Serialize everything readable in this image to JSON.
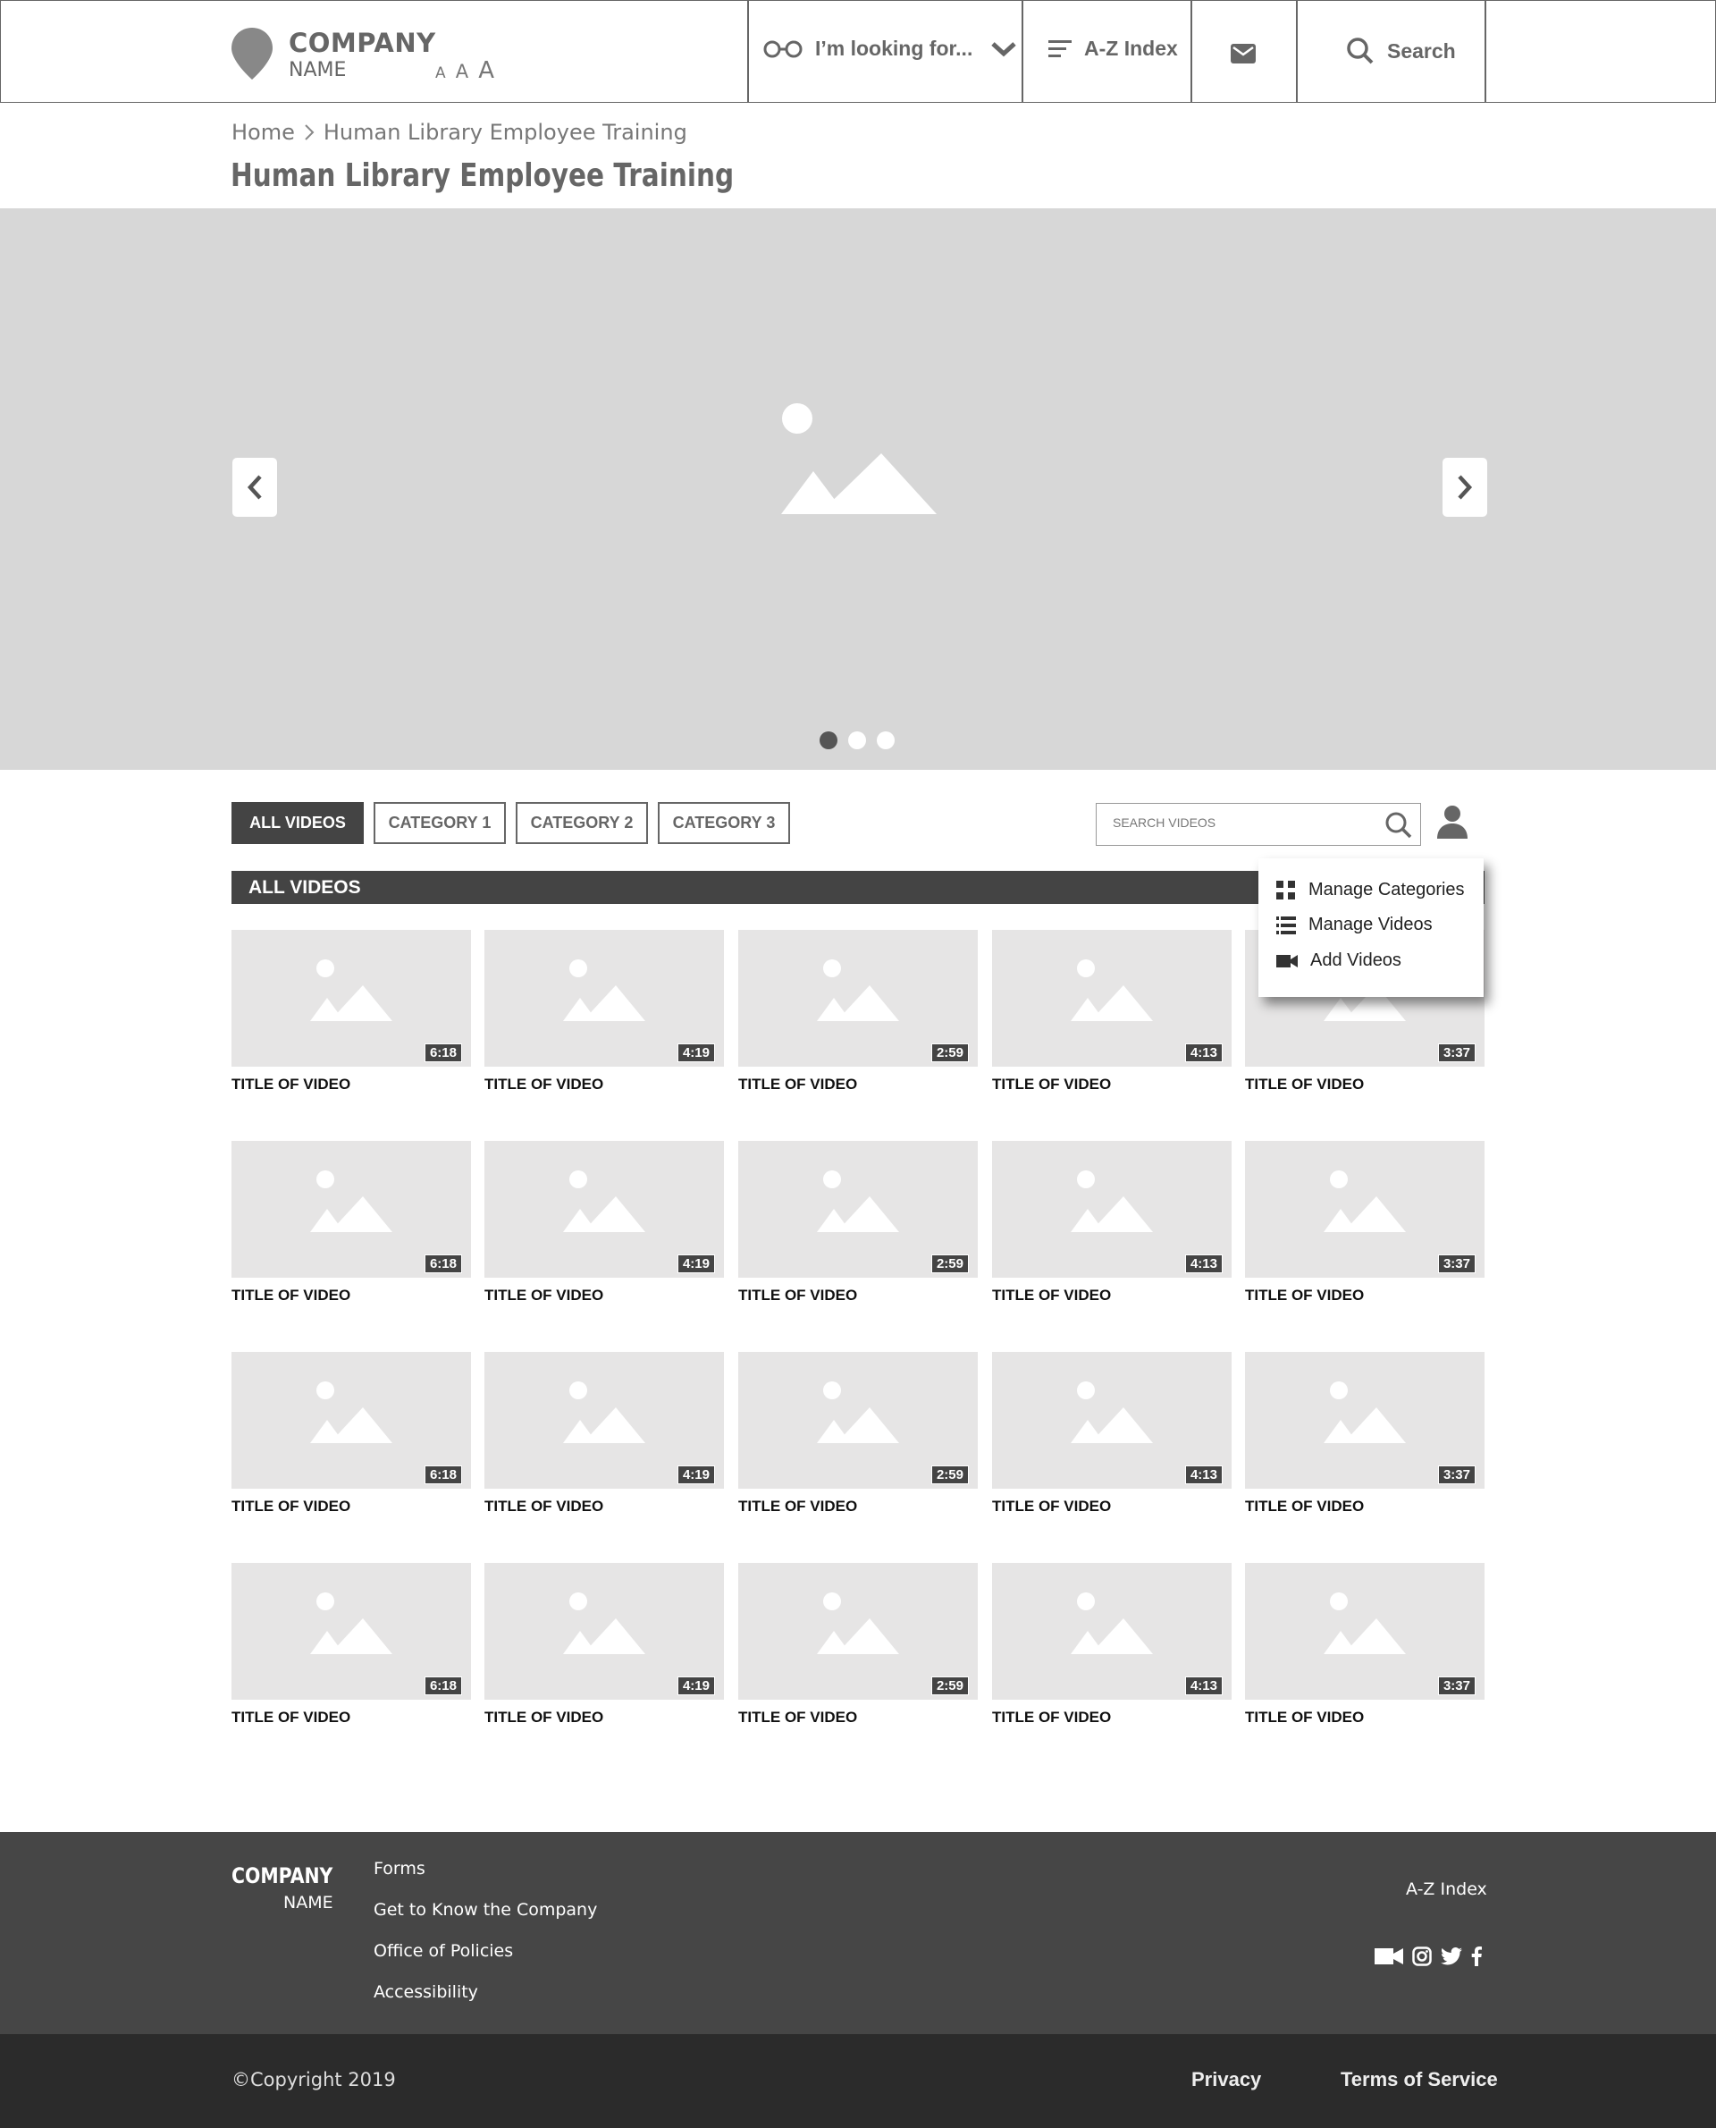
{
  "header": {
    "company": "COMPANY",
    "company_sub": "NAME",
    "font_sizes": [
      "A",
      "A",
      "A"
    ],
    "looking_for": "I’m looking for...",
    "az_index": "A-Z Index",
    "search": "Search",
    "icons": {
      "logo": "map-pin-icon",
      "looking": "glasses-icon",
      "chevron": "chevron-down-icon",
      "az": "list-icon",
      "mail": "envelope-icon",
      "search": "search-icon"
    }
  },
  "breadcrumb": {
    "home": "Home",
    "current": "Human Library Employee Training"
  },
  "page_title": "Human Library Employee Training",
  "carousel": {
    "slide_count": 3,
    "active_slide": 1
  },
  "filters": [
    "ALL VIDEOS",
    "CATEGORY 1",
    "CATEGORY 2",
    "CATEGORY 3"
  ],
  "video_search": {
    "placeholder": "SEARCH VIDEOS"
  },
  "section_title": "ALL VIDEOS",
  "admin_menu": [
    {
      "label": "Manage Categories",
      "icon": "grid-icon"
    },
    {
      "label": "Manage Videos",
      "icon": "list-icon"
    },
    {
      "label": "Add Videos",
      "icon": "video-camera-icon"
    }
  ],
  "videos": {
    "title": "TITLE OF VIDEO",
    "durations": [
      "6:18",
      "4:19",
      "2:59",
      "4:13",
      "3:37"
    ],
    "rows": 4
  },
  "footer": {
    "company": "COMPANY",
    "company_sub": "NAME",
    "links": [
      "Forms",
      "Get to Know the Company",
      "Office of Policies",
      "Accessibility"
    ],
    "az_index": "A-Z Index",
    "social_icons": [
      "video-camera-icon",
      "instagram-icon",
      "twitter-icon",
      "facebook-icon"
    ],
    "copyright": "Copyright 2019",
    "privacy": "Privacy",
    "terms": "Terms of Service"
  },
  "colors": {
    "dark": "#444444",
    "footer": "#464646",
    "bottom_bar": "#2b2b2b",
    "placeholder": "#d7d7d7",
    "thumb": "#e6e5e5"
  }
}
